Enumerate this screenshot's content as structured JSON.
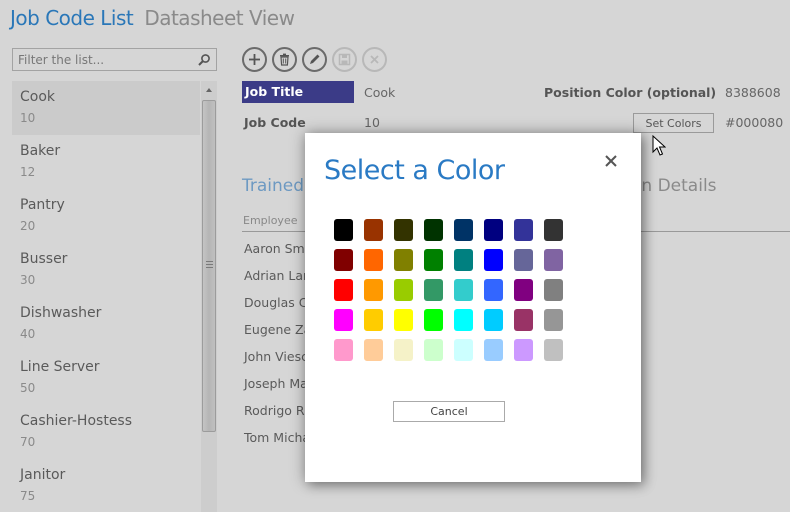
{
  "header": {
    "app_title": "Job Code List",
    "view_title": "Datasheet View"
  },
  "filter": {
    "placeholder": "Filter the list...",
    "value": "",
    "icon": "search-icon"
  },
  "job_list": [
    {
      "name": "Cook",
      "code": "10",
      "selected": true
    },
    {
      "name": "Baker",
      "code": "12"
    },
    {
      "name": "Pantry",
      "code": "20"
    },
    {
      "name": "Busser",
      "code": "30"
    },
    {
      "name": "Dishwasher",
      "code": "40"
    },
    {
      "name": "Line Server",
      "code": "50"
    },
    {
      "name": "Cashier-Hostess",
      "code": "70"
    },
    {
      "name": "Janitor",
      "code": "75"
    }
  ],
  "toolbar": {
    "buttons": [
      {
        "name": "add-button",
        "icon": "plus-icon",
        "enabled": true
      },
      {
        "name": "delete-button",
        "icon": "trash-icon",
        "enabled": true
      },
      {
        "name": "edit-button",
        "icon": "pencil-icon",
        "enabled": true
      },
      {
        "name": "save-button",
        "icon": "save-icon",
        "enabled": false
      },
      {
        "name": "cancel-edit-button",
        "icon": "close-icon",
        "enabled": false
      }
    ]
  },
  "form": {
    "job_title_label": "Job Title",
    "job_title_value": "Cook",
    "job_code_label": "Job Code",
    "job_code_value": "10",
    "position_color_label": "Position Color (optional)",
    "position_color_value": "8388608",
    "position_color_hex": "#000080",
    "set_colors_label": "Set Colors"
  },
  "trained_section": {
    "title": "Trained",
    "column_header": "Employee",
    "employees": [
      "Aaron Smi",
      "Adrian Lar",
      "Douglas C",
      "Eugene Za",
      "John Viesc",
      "Joseph Ma",
      "Rodrigo R",
      "Tom Micha"
    ]
  },
  "plan_section": {
    "title_fragment": "an Details"
  },
  "modal": {
    "title": "Select a Color",
    "cancel_label": "Cancel",
    "swatches": [
      "#000000",
      "#993300",
      "#333300",
      "#003300",
      "#003366",
      "#000080",
      "#333399",
      "#333333",
      "#800000",
      "#FF6600",
      "#808000",
      "#008000",
      "#008080",
      "#0000FF",
      "#666699",
      "#8064A2",
      "#FF0000",
      "#FF9900",
      "#99CC00",
      "#339966",
      "#33CCCC",
      "#3366FF",
      "#800080",
      "#808080",
      "#FF00FF",
      "#FFCC00",
      "#FFFF00",
      "#00FF00",
      "#00FFFF",
      "#00CCFF",
      "#993366",
      "#969696",
      "#FF99CC",
      "#FFCC99",
      "#F5F2C8",
      "#CCFFCC",
      "#CCFFFF",
      "#99CCFF",
      "#CC99FF",
      "#C0C0C0"
    ]
  }
}
